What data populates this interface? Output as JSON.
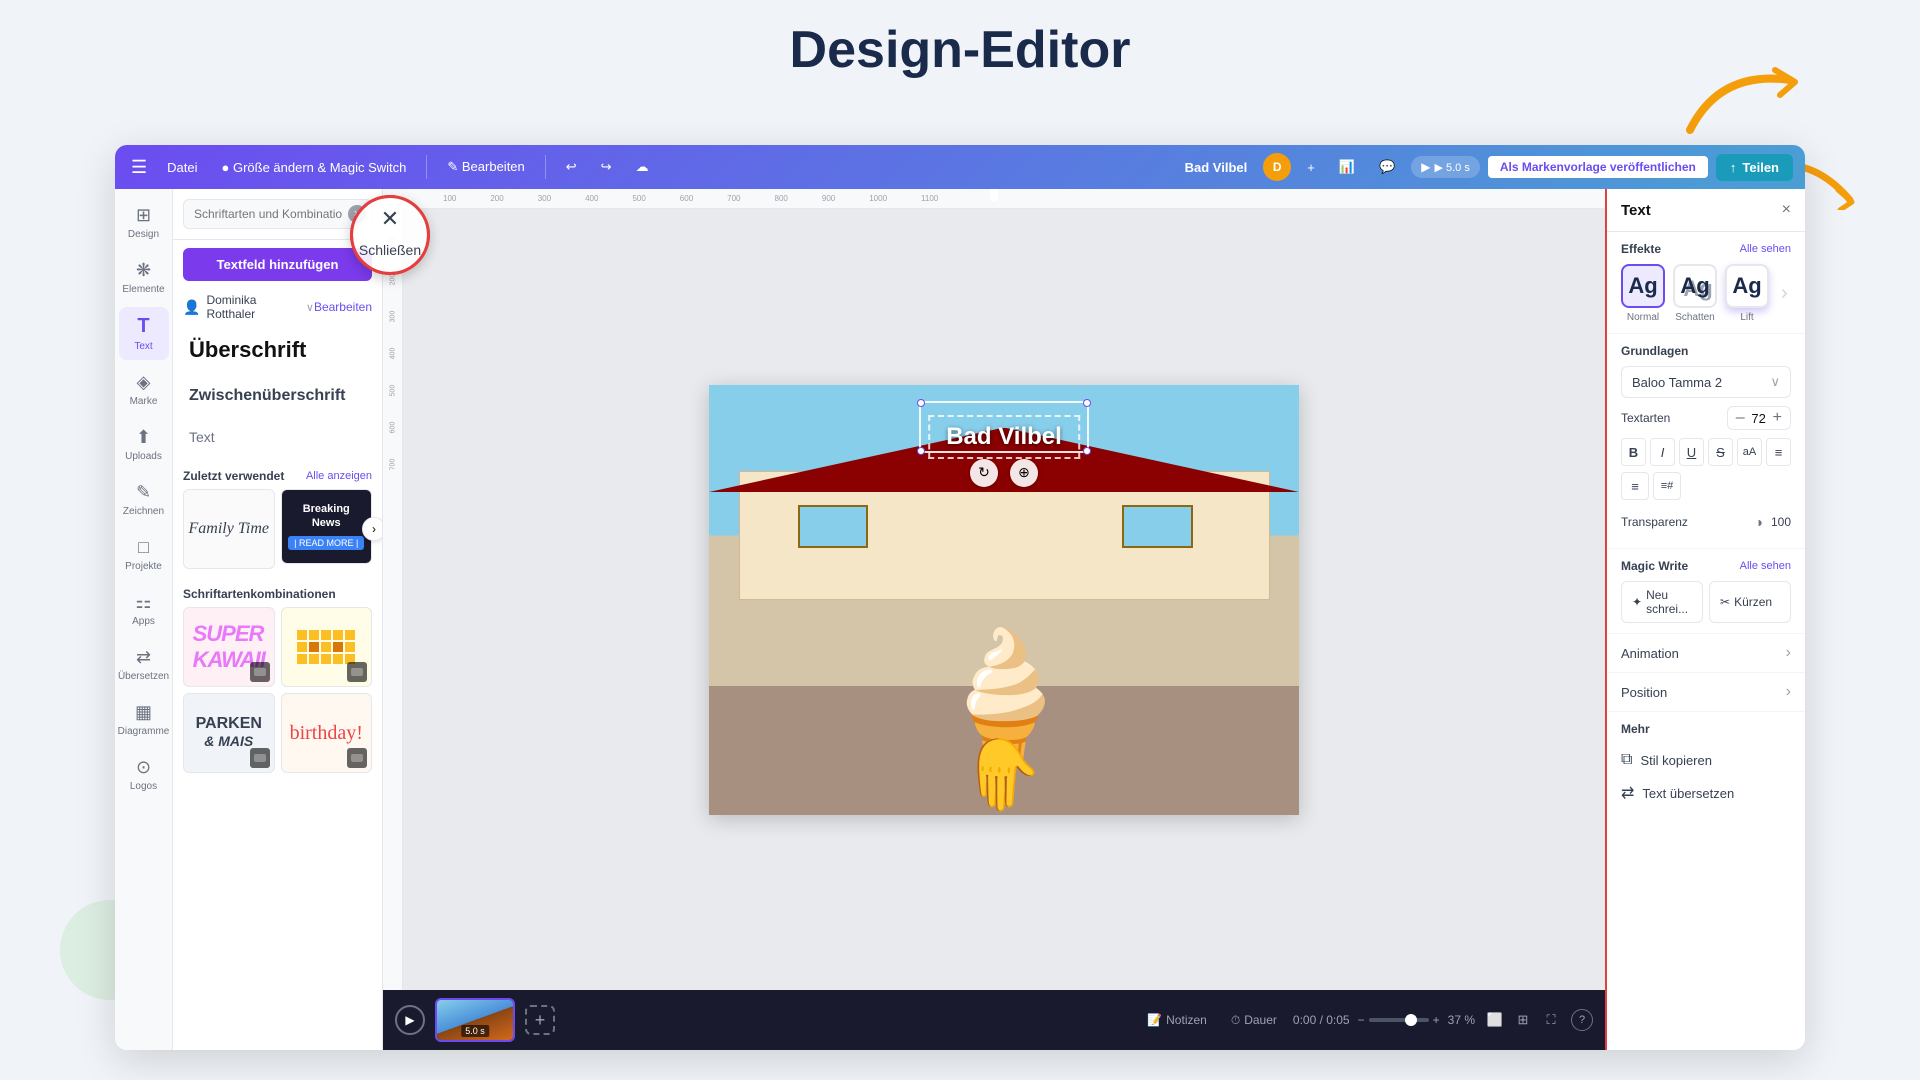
{
  "page": {
    "title": "Design-Editor"
  },
  "toolbar": {
    "menu_label": "☰",
    "file_label": "Datei",
    "size_change_label": "● Größe ändern & Magic Switch",
    "edit_label": "✎ Bearbeiten",
    "edit_arrow": "∨",
    "undo_label": "↩",
    "redo_label": "↪",
    "cloud_label": "☁",
    "brand_label": "Bad Vilbel",
    "play_label": "▶ 5.0 s",
    "publish_label": "Als Markenvorlage veröffentlichen",
    "share_label": "Teilen",
    "share_icon": "↑"
  },
  "sidebar": {
    "items": [
      {
        "id": "design",
        "icon": "⊞",
        "label": "Design"
      },
      {
        "id": "elements",
        "icon": "❋",
        "label": "Elemente"
      },
      {
        "id": "text",
        "icon": "T",
        "label": "Text"
      },
      {
        "id": "brand",
        "icon": "◈",
        "label": "Marke"
      },
      {
        "id": "uploads",
        "icon": "⬆",
        "label": "Uploads"
      },
      {
        "id": "draw",
        "icon": "✎",
        "label": "Zeichnen"
      },
      {
        "id": "projects",
        "icon": "□",
        "label": "Projekte"
      },
      {
        "id": "apps",
        "icon": "⚏",
        "label": "Apps"
      },
      {
        "id": "translate",
        "icon": "⇄",
        "label": "Übersetzen"
      },
      {
        "id": "charts",
        "icon": "▦",
        "label": "Diagramme"
      },
      {
        "id": "logos",
        "icon": "⊙",
        "label": "Logos"
      }
    ]
  },
  "text_panel": {
    "search_placeholder": "Schriftarten und Kombinationen suc",
    "add_textfield_label": "Textfeld hinzufügen",
    "close_tooltip": "Schließen",
    "author_label": "Dominika Rotthaler",
    "author_arrow": "∨",
    "edit_label": "Bearbeiten",
    "heading_label": "Überschrift",
    "subheading_label": "Zwischenüberschrift",
    "text_label": "Text",
    "recent_label": "Zuletzt verwendet",
    "see_all_label": "Alle anzeigen",
    "recent_templates": [
      {
        "id": "family",
        "text": "Family Time",
        "type": "cursive"
      },
      {
        "id": "breaking",
        "text": "Breaking News",
        "type": "news"
      }
    ],
    "font_combos_label": "Schriftartenkombinationen",
    "font_combos": [
      {
        "id": "kawaii",
        "type": "kawaii"
      },
      {
        "id": "yellow",
        "type": "yellow"
      },
      {
        "id": "parking",
        "text": "PARKEN & MAIS",
        "type": "parking"
      },
      {
        "id": "birthday",
        "text": "birthday!",
        "type": "birthday"
      }
    ]
  },
  "canvas": {
    "slide_text": "Bad Vilbel",
    "ruler_marks": [
      "",
      "100",
      "200",
      "300",
      "400",
      "500",
      "600",
      "700",
      "800",
      "900",
      "1000",
      "1100"
    ]
  },
  "timeline": {
    "play_icon": "▶",
    "time_display": "0:00 / 0:05",
    "slide_time": "5.0 s",
    "zoom_level": "37 %",
    "notes_label": "Notizen",
    "duration_label": "Dauer",
    "add_label": "+"
  },
  "right_panel": {
    "title": "Text",
    "close_label": "×",
    "effects_label": "Effekte",
    "see_all_label": "Alle sehen",
    "effects": [
      {
        "id": "normal",
        "label": "Normal",
        "active": true
      },
      {
        "id": "shadow",
        "label": "Schatten",
        "active": false
      },
      {
        "id": "lift",
        "label": "Lift",
        "active": false
      }
    ],
    "basics_label": "Grundlagen",
    "font_name": "Baloo Tamma 2",
    "font_sizes_label": "Textarten",
    "font_size_value": "72",
    "font_decrease": "–",
    "font_increase": "+",
    "format_buttons": [
      {
        "id": "bold",
        "label": "B"
      },
      {
        "id": "italic",
        "label": "I"
      },
      {
        "id": "underline",
        "label": "U"
      },
      {
        "id": "strikethrough",
        "label": "S"
      },
      {
        "id": "case",
        "label": "aA"
      },
      {
        "id": "align",
        "label": "≡"
      }
    ],
    "list_buttons": [
      {
        "id": "bullets",
        "label": "≡"
      },
      {
        "id": "numbers",
        "label": "≡#"
      }
    ],
    "transparency_label": "Transparenz",
    "transparency_value": "100",
    "magic_write_label": "Magic Write",
    "magic_write_see_all": "Alle sehen",
    "magic_write_new": "Neu schrei...",
    "magic_write_shorten": "Kürzen",
    "animation_label": "Animation",
    "position_label": "Position",
    "more_label": "Mehr",
    "copy_style_label": "Stil kopieren",
    "translate_label": "Text übersetzen"
  }
}
